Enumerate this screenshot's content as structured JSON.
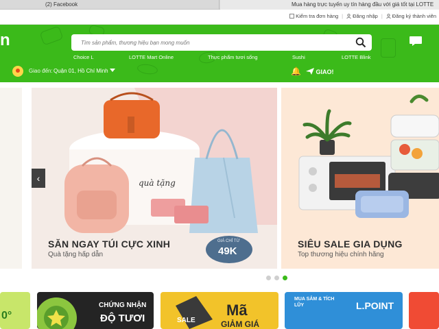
{
  "browser": {
    "tabs": [
      {
        "label": "(2) Facebook"
      },
      {
        "label": "Mua hàng trực tuyến uy tín hàng đầu với giá tốt tại LOTTE"
      }
    ]
  },
  "topbar": {
    "links": [
      {
        "label": "Kiểm tra đơn hàng",
        "icon": "order-icon"
      },
      {
        "label": "Đăng nhập",
        "icon": "user-icon"
      },
      {
        "label": "Đăng ký thành viên",
        "icon": "user-add-icon"
      }
    ]
  },
  "header": {
    "logo": "n",
    "search_placeholder": "Tìm sản phẩm, thương hiệu bạn mong muốn",
    "nav": [
      {
        "label": "Choice L"
      },
      {
        "label": "LOTTE Mart Online"
      },
      {
        "label": "Thực phẩm tươi sống"
      },
      {
        "label": "Sushi"
      },
      {
        "label": "LOTTE Blink"
      }
    ],
    "location_label": "Giao đến:",
    "location_value": "Quận 01, Hồ Chí Minh",
    "giao_label": "GIAO!",
    "accent": "#3bba1a"
  },
  "banners": {
    "main": {
      "title": "SĂN NGAY TÚI CỰC XINH",
      "subtitle": "Quà tặng hấp dẫn",
      "gift_tag": "quà tặng",
      "price_label": "GIÁ CHỈ TỪ",
      "price": "49K"
    },
    "right": {
      "title": "SIÊU SALE GIA DỤNG",
      "subtitle": "Top thương hiệu chính hãng"
    },
    "dots": 3,
    "active_dot": 3
  },
  "promos": [
    {
      "text": "0°"
    },
    {
      "text": "CHỨNG NHẬN",
      "text2": "ĐỘ TƯƠI"
    },
    {
      "text": "Mã",
      "text2": "GIẢM GIÁ",
      "badge": "SALE"
    },
    {
      "text": "L.POINT",
      "text2": "MUA SẮM & TÍCH LŨY"
    },
    {
      "text": ""
    }
  ]
}
